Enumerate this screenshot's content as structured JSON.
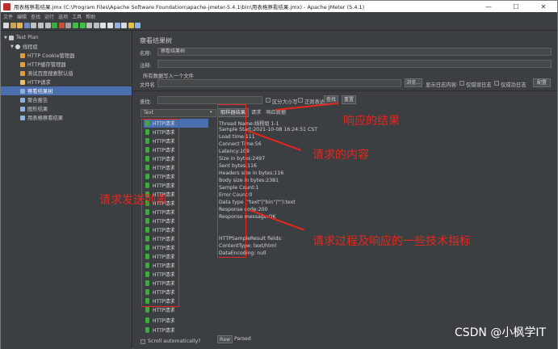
{
  "window": {
    "title": "用表格察看结果.jmx (C:\\Program Files\\Apache Software Foundation\\apache-jmeter-5.4.1\\bin\\用表格察看结果.jmx) - Apache JMeter (5.4.1)",
    "minimize": "—",
    "maximize": "☐",
    "close": "✕"
  },
  "menu": [
    "文件",
    "编辑",
    "查找",
    "运行",
    "选项",
    "工具",
    "帮助"
  ],
  "tree": {
    "items": [
      {
        "label": "Test Plan",
        "icon": "test-plan-icon"
      },
      {
        "label": "线程组",
        "icon": "thread-group-icon"
      },
      {
        "label": "HTTP Cookie管理器",
        "icon": "wrench-icon"
      },
      {
        "label": "HTTP缓存管理器",
        "icon": "wrench-icon"
      },
      {
        "label": "测试百度搜索默认值",
        "icon": "wrench-icon"
      },
      {
        "label": "HTTP请求",
        "icon": "pencil-icon"
      },
      {
        "label": "察看结果树",
        "icon": "chart-icon"
      },
      {
        "label": "聚合报告",
        "icon": "chart-icon"
      },
      {
        "label": "图形结果",
        "icon": "chart-icon"
      },
      {
        "label": "用表格察看结果",
        "icon": "chart-icon"
      }
    ]
  },
  "panel": {
    "heading": "察看结果树",
    "name_label": "名称:",
    "name_value": "察看结果树",
    "comment_label": "注释:",
    "section_title": "所有数据写入一个文件",
    "filename_label": "文件名",
    "browse_button": "浏览...",
    "log_content_label": "显示日志内容:",
    "errors_only": "仅错误日志",
    "success_only": "仅成功日志",
    "configure_button": "配置",
    "search_label": "查找:",
    "case_sensitive": "区分大小写",
    "regex": "正则表达式",
    "find_button": "查找",
    "reset_button": "重置",
    "renderer_select": "Text",
    "scroll_auto": "Scroll automatically?"
  },
  "samples": [
    "HTTP请求",
    "HTTP请求",
    "HTTP请求",
    "HTTP请求",
    "HTTP请求",
    "HTTP请求",
    "HTTP请求",
    "HTTP请求",
    "HTTP请求",
    "HTTP请求",
    "HTTP请求",
    "HTTP请求",
    "HTTP请求",
    "HTTP请求",
    "HTTP请求",
    "HTTP请求",
    "HTTP请求",
    "HTTP请求",
    "HTTP请求",
    "HTTP请求",
    "HTTP请求",
    "HTTP请求",
    "HTTP请求",
    "HTTP请求"
  ],
  "tabs": [
    "取样器结果",
    "请求",
    "响应数据"
  ],
  "bottom_tabs": [
    "Raw",
    "Parsed"
  ],
  "result_lines": [
    "Thread Name:线程组 1-1",
    "Sample Start:2021-10-08 16:24:51 CST",
    "Load time:111",
    "Connect Time:56",
    "Latency:109",
    "Size in bytes:2497",
    "Sent bytes:116",
    "Headers size in bytes:116",
    "Body size in bytes:2381",
    "Sample Count:1",
    "Error Count:0",
    "Data type (\"text\"|\"bin\"|\"\"):text",
    "Response code:200",
    "Response message:OK",
    "",
    "",
    "HTTPSampleResult fields:",
    "ContentType: text/html",
    "DataEncoding: null"
  ],
  "annotations": {
    "response_result": "响应的结果",
    "request_content": "请求的内容",
    "request_list": "请求发送列表",
    "tech_metrics": "请求过程及响应的一些技术指标"
  },
  "watermark": "CSDN @小枫学IT",
  "colors": {
    "annotation_red": "#e8261e",
    "selection_blue": "#4b6eaf",
    "success_green": "#3faa3f",
    "panel_bg": "#3c3f41"
  }
}
